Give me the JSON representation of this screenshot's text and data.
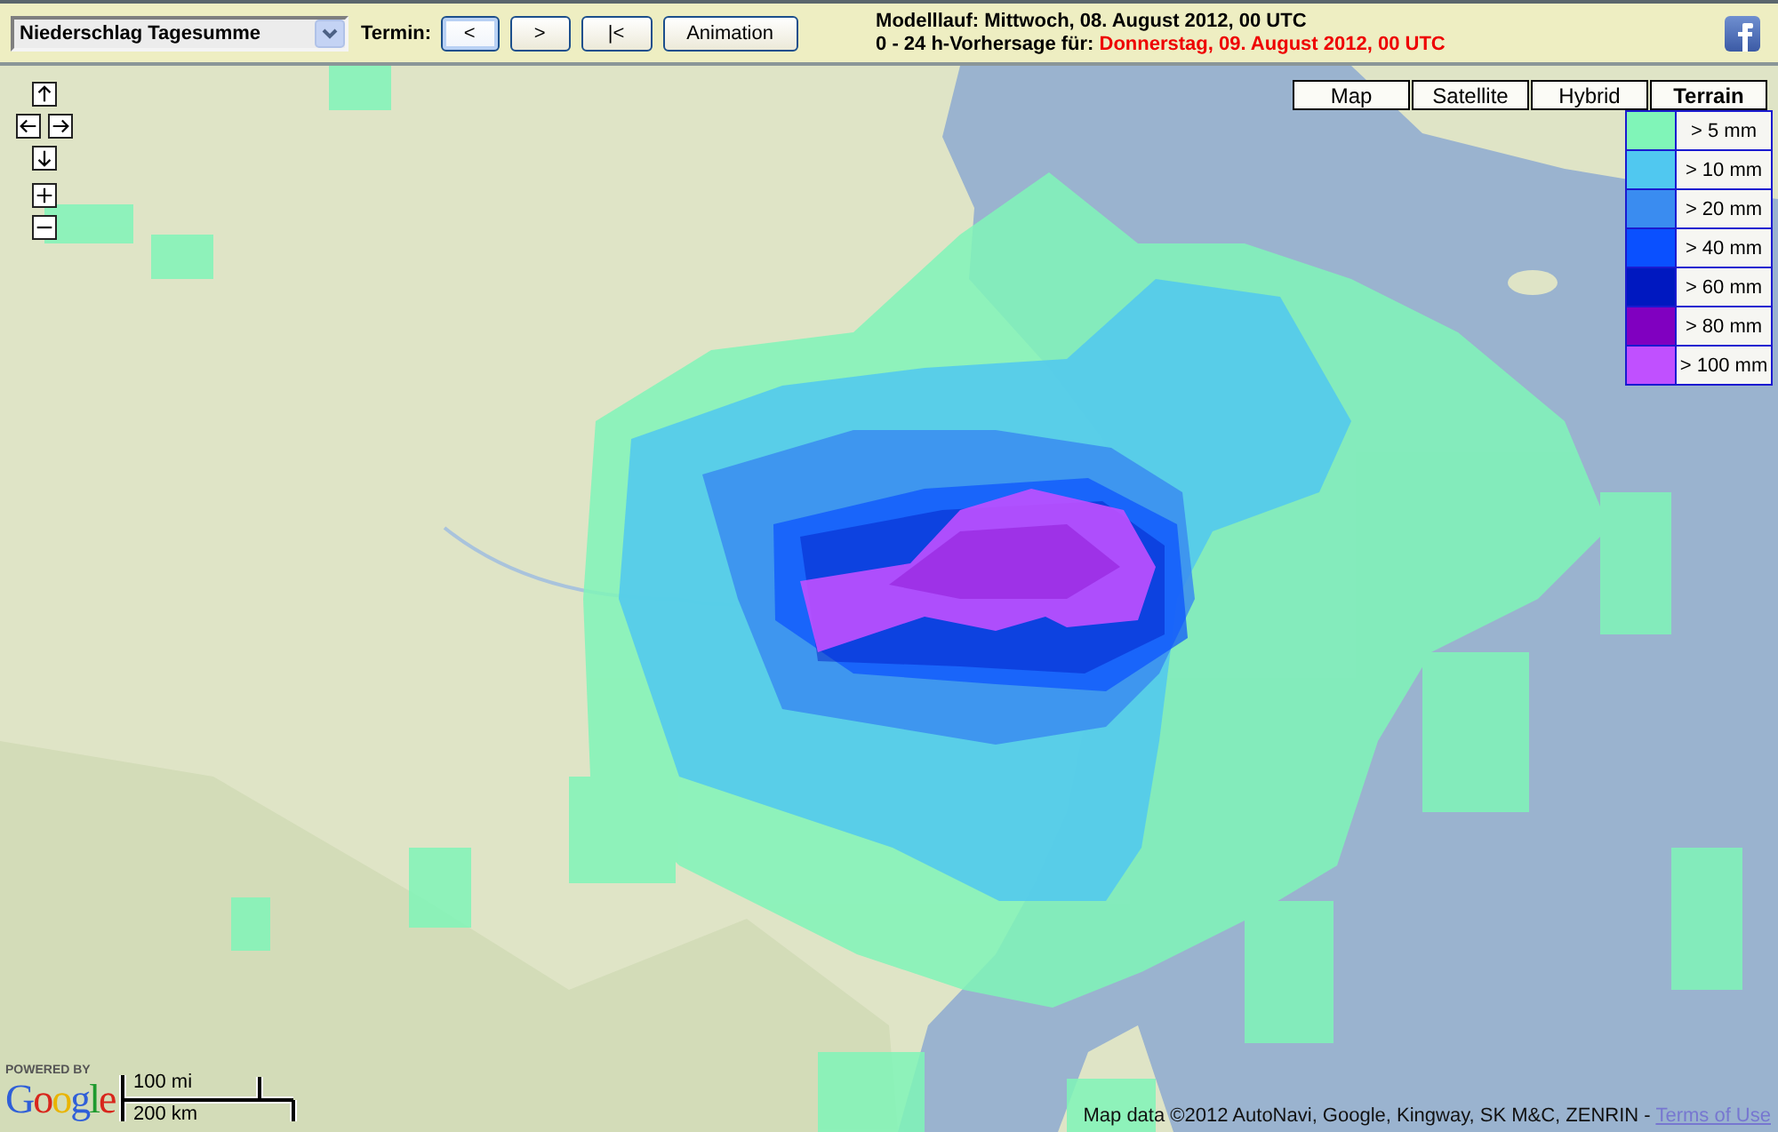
{
  "toolbar": {
    "product_select": {
      "value": "Niederschlag Tagesumme"
    },
    "termin_label": "Termin:",
    "buttons": [
      {
        "label": "<",
        "focused": true
      },
      {
        "label": ">",
        "focused": false
      },
      {
        "label": "|<",
        "focused": false
      },
      {
        "label": "Animation",
        "focused": false
      }
    ],
    "model_run": "Modelllauf: Mittwoch, 08. August 2012, 00 UTC",
    "forecast_label": "0 - 24 h-Vorhersage für:",
    "forecast_date": "Donnerstag, 09. August 2012, 00 UTC"
  },
  "map": {
    "type_buttons": [
      {
        "label": "Map",
        "selected": false
      },
      {
        "label": "Satellite",
        "selected": false
      },
      {
        "label": "Hybrid",
        "selected": false
      },
      {
        "label": "Terrain",
        "selected": true
      }
    ],
    "legend": [
      {
        "label": "> 5 mm",
        "color": "#80f5b8"
      },
      {
        "label": "> 10 mm",
        "color": "#50c8f0"
      },
      {
        "label": "> 20 mm",
        "color": "#3a8cf0"
      },
      {
        "label": "> 40 mm",
        "color": "#0a50ff"
      },
      {
        "label": "> 60 mm",
        "color": "#0018c0"
      },
      {
        "label": "> 80 mm",
        "color": "#8000c0"
      },
      {
        "label": "> 100 mm",
        "color": "#c050ff"
      }
    ],
    "branding": {
      "powered_by": "POWERED BY",
      "logo": "Google"
    },
    "scale": {
      "miles": "100 mi",
      "kilometers": "200 km"
    },
    "attribution": {
      "text": "Map data ©2012 AutoNavi, Google, Kingway, SK M&C, ZENRIN -",
      "link": "Terms of Use"
    }
  }
}
